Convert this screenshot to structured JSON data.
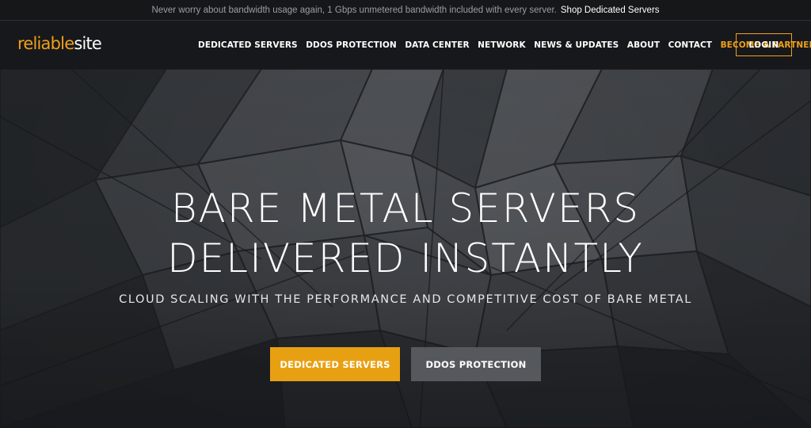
{
  "announcement": {
    "text": "Never worry about bandwidth usage again, 1 Gbps unmetered bandwidth included with every server.",
    "link_label": "Shop Dedicated Servers"
  },
  "header": {
    "logo": {
      "part_a": "reliable",
      "part_b": "site"
    },
    "nav": [
      {
        "label": "DEDICATED SERVERS"
      },
      {
        "label": "DDOS PROTECTION"
      },
      {
        "label": "DATA CENTER"
      },
      {
        "label": "NETWORK"
      },
      {
        "label": "NEWS & UPDATES"
      },
      {
        "label": "ABOUT"
      },
      {
        "label": "CONTACT"
      },
      {
        "label": "BECOME A PARTNER"
      }
    ],
    "login_label": "LOGIN"
  },
  "hero": {
    "headline_line1": "BARE METAL SERVERS",
    "headline_line2": "DELIVERED INSTANTLY",
    "subheadline": "CLOUD SCALING WITH THE PERFORMANCE AND COMPETITIVE COST OF BARE METAL",
    "primary_button": "DEDICATED SERVERS",
    "secondary_button": "DDOS PROTECTION"
  },
  "colors": {
    "accent": "#f0a11a",
    "primary_button": "#e8a013",
    "secondary_button": "#55585c",
    "background": "#1b1d20"
  }
}
